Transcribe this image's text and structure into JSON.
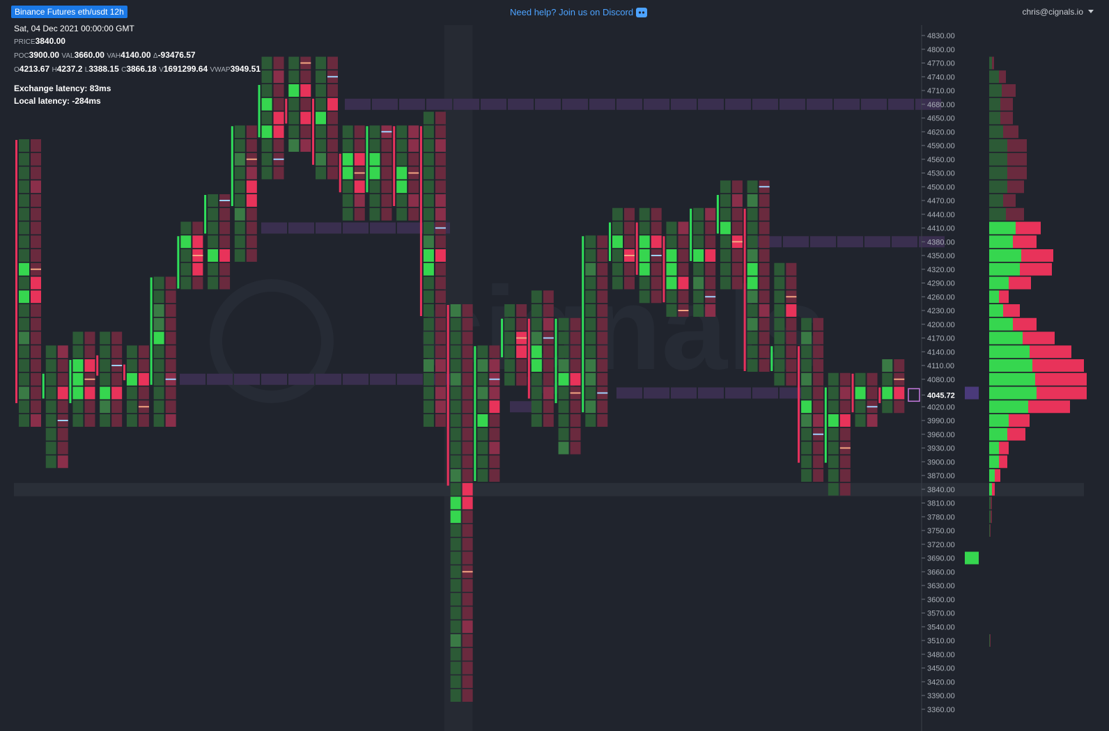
{
  "header": {
    "badge": "Binance Futures eth/usdt 12h",
    "help_text": "Need help? Join us on Discord",
    "user": "chris@cignals.io"
  },
  "info": {
    "date": "Sat, 04 Dec 2021 00:00:00 GMT",
    "price_label": "PRICE",
    "price": "3840.00",
    "poc_label": "POC",
    "poc": "3900.00",
    "val_label": "VAL",
    "val": "3660.00",
    "vah_label": "VAH",
    "vah": "4140.00",
    "delta_label": "Δ",
    "delta": "-93476.57",
    "o_label": "O",
    "o": "4213.67",
    "h_label": "H",
    "h": "4237.2",
    "l_label": "L",
    "l": "3388.15",
    "c_label": "C",
    "c": "3866.18",
    "v_label": "V",
    "v": "1691299.64",
    "vwap_label": "VWAP",
    "vwap": "3949.51",
    "exchange_latency": "Exchange latency: 83ms",
    "local_latency": "Local latency: -284ms"
  },
  "colors": {
    "background": "#20242d",
    "bid_green": "#2c5a36",
    "bid_green_bright": "#36d64f",
    "ask_red": "#6a2a3e",
    "ask_red_bright": "#e8335a",
    "bar_green": "#2fe05a",
    "bar_red": "#e8325c",
    "naked_poc": "#3a2f4f",
    "accent": "#1b79e6"
  },
  "price_axis": {
    "ticks": [
      "4830.00",
      "4800.00",
      "4770.00",
      "4740.00",
      "4710.00",
      "4680.00",
      "4650.00",
      "4620.00",
      "4590.00",
      "4560.00",
      "4530.00",
      "4500.00",
      "4470.00",
      "4440.00",
      "4410.00",
      "4380.00",
      "4350.00",
      "4320.00",
      "4290.00",
      "4260.00",
      "4230.00",
      "4200.00",
      "4170.00",
      "4140.00",
      "4110.00",
      "4080.00",
      "4045.72",
      "4020.00",
      "3990.00",
      "3960.00",
      "3930.00",
      "3900.00",
      "3870.00",
      "3840.00",
      "3810.00",
      "3780.00",
      "3750.00",
      "3720.00",
      "3690.00",
      "3660.00",
      "3630.00",
      "3600.00",
      "3570.00",
      "3540.00",
      "3510.00",
      "3480.00",
      "3450.00",
      "3420.00",
      "3390.00",
      "3360.00"
    ],
    "current_price": "4045.72"
  },
  "watermark": "cignals",
  "chart_data": {
    "type": "footprint",
    "tick_size": 30,
    "candles": [
      {
        "open": 4590,
        "close": 4040,
        "high": 4590,
        "low": 3990
      },
      {
        "open": 4050,
        "close": 4080,
        "high": 4140,
        "low": 3900
      },
      {
        "open": 4040,
        "close": 4110,
        "high": 4170,
        "low": 3990
      },
      {
        "open": 4120,
        "close": 4100,
        "high": 4170,
        "low": 3990
      },
      {
        "open": 4100,
        "close": 4090,
        "high": 4140,
        "low": 3990
      },
      {
        "open": 4080,
        "close": 4290,
        "high": 4290,
        "low": 3990
      },
      {
        "open": 4290,
        "close": 4380,
        "high": 4410,
        "low": 4290
      },
      {
        "open": 4410,
        "close": 4470,
        "high": 4470,
        "low": 4290
      },
      {
        "open": 4470,
        "close": 4620,
        "high": 4620,
        "low": 4350
      },
      {
        "open": 4620,
        "close": 4710,
        "high": 4770,
        "low": 4530
      },
      {
        "open": 4680,
        "close": 4650,
        "high": 4770,
        "low": 4590
      },
      {
        "open": 4680,
        "close": 4560,
        "high": 4770,
        "low": 4530
      },
      {
        "open": 4560,
        "close": 4500,
        "high": 4620,
        "low": 4440
      },
      {
        "open": 4500,
        "close": 4620,
        "high": 4620,
        "low": 4440
      },
      {
        "open": 4620,
        "close": 4470,
        "high": 4620,
        "low": 4440
      },
      {
        "open": 4620,
        "close": 4230,
        "high": 4650,
        "low": 3990
      },
      {
        "open": 4230,
        "close": 3860,
        "high": 4230,
        "low": 3390
      },
      {
        "open": 3870,
        "close": 4140,
        "high": 4140,
        "low": 3870
      },
      {
        "open": 4140,
        "close": 4200,
        "high": 4230,
        "low": 4080
      },
      {
        "open": 4200,
        "close": 4050,
        "high": 4260,
        "low": 3990
      },
      {
        "open": 4040,
        "close": 4200,
        "high": 4200,
        "low": 3930
      },
      {
        "open": 4020,
        "close": 4380,
        "high": 4380,
        "low": 3990
      },
      {
        "open": 4350,
        "close": 4410,
        "high": 4440,
        "low": 4290
      },
      {
        "open": 4410,
        "close": 4320,
        "high": 4440,
        "low": 4260
      },
      {
        "open": 4380,
        "close": 4260,
        "high": 4410,
        "low": 4230
      },
      {
        "open": 4350,
        "close": 4440,
        "high": 4440,
        "low": 4230
      },
      {
        "open": 4410,
        "close": 4470,
        "high": 4500,
        "low": 4290
      },
      {
        "open": 4440,
        "close": 4110,
        "high": 4500,
        "low": 4110
      },
      {
        "open": 4110,
        "close": 4140,
        "high": 4320,
        "low": 4080
      },
      {
        "open": 4140,
        "close": 3910,
        "high": 4200,
        "low": 3870
      },
      {
        "open": 3910,
        "close": 4050,
        "high": 4080,
        "low": 3840
      },
      {
        "open": 4080,
        "close": 4020,
        "high": 4080,
        "low": 3990
      },
      {
        "open": 4050,
        "close": 4040,
        "high": 4110,
        "low": 4020
      }
    ]
  }
}
